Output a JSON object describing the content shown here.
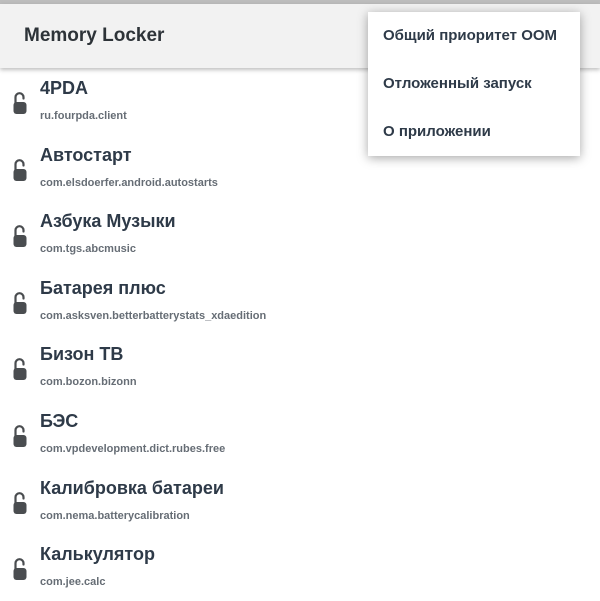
{
  "app_bar": {
    "title": "Memory Locker"
  },
  "apps": [
    {
      "name": "4PDA",
      "package": "ru.fourpda.client"
    },
    {
      "name": "Автостарт",
      "package": "com.elsdoerfer.android.autostarts"
    },
    {
      "name": "Азбука Музыки",
      "package": "com.tgs.abcmusic"
    },
    {
      "name": "Батарея плюс",
      "package": "com.asksven.betterbatterystats_xdaedition"
    },
    {
      "name": "Бизон ТВ",
      "package": "com.bozon.bizonn"
    },
    {
      "name": "БЭС",
      "package": "com.vpdevelopment.dict.rubes.free"
    },
    {
      "name": "Калибровка батареи",
      "package": "com.nema.batterycalibration"
    },
    {
      "name": "Калькулятор",
      "package": "com.jee.calc"
    }
  ],
  "overflow_menu": {
    "items": [
      {
        "label": "Общий приоритет OOM"
      },
      {
        "label": "Отложенный запуск"
      },
      {
        "label": "О приложении"
      }
    ]
  },
  "icons": {
    "lock": "unlocked-padlock-icon"
  },
  "colors": {
    "app_bar": "#f2f2f2",
    "title_text": "#2d3338",
    "item_text": "#2e3a48",
    "package_text": "#666d75",
    "lock_icon": "#4a4d50"
  }
}
